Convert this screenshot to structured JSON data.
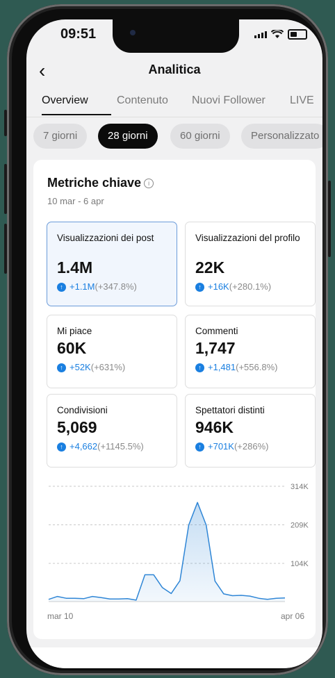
{
  "status": {
    "time": "09:51"
  },
  "header": {
    "title": "Analitica"
  },
  "tabs": [
    {
      "label": "Overview"
    },
    {
      "label": "Contenuto"
    },
    {
      "label": "Nuovi Follower"
    },
    {
      "label": "LIVE"
    }
  ],
  "ranges": [
    {
      "label": "7 giorni"
    },
    {
      "label": "28 giorni"
    },
    {
      "label": "60 giorni"
    },
    {
      "label": "Personalizzato"
    }
  ],
  "section": {
    "title": "Metriche chiave",
    "range": "10 mar - 6 apr"
  },
  "metrics": [
    {
      "label": "Visualizzazioni dei post",
      "value": "1.4M",
      "delta": "+1.1M",
      "pct": "(+347.8%)"
    },
    {
      "label": "Visualizzazioni del profilo",
      "value": "22K",
      "delta": "+16K",
      "pct": "(+280.1%)"
    },
    {
      "label": "Mi piace",
      "value": "60K",
      "delta": "+52K",
      "pct": "(+631%)"
    },
    {
      "label": "Commenti",
      "value": "1,747",
      "delta": "+1,481",
      "pct": "(+556.8%)"
    },
    {
      "label": "Condivisioni",
      "value": "5,069",
      "delta": "+4,662",
      "pct": "(+1145.5%)"
    },
    {
      "label": "Spettatori distinti",
      "value": "946K",
      "delta": "+701K",
      "pct": "(+286%)"
    }
  ],
  "chart_data": {
    "type": "area",
    "series_color": "#2f86d6",
    "x_start_label": "mar 10",
    "x_end_label": "apr 06",
    "y_tick_labels": [
      "314K",
      "209K",
      "104K"
    ],
    "y_ticks": [
      314000,
      209000,
      104000
    ],
    "ylim": [
      0,
      314000
    ],
    "grid": true,
    "values": [
      6000,
      14000,
      9000,
      9000,
      8000,
      14000,
      11000,
      7000,
      7000,
      8000,
      4000,
      73000,
      73000,
      38000,
      22000,
      57000,
      208000,
      270000,
      208000,
      56000,
      21000,
      16000,
      17000,
      15000,
      9000,
      6000,
      9000,
      10000
    ]
  }
}
